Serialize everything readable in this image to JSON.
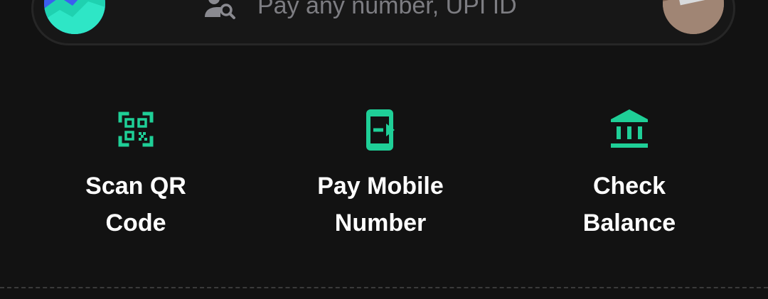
{
  "search": {
    "placeholder": "Pay any number, UPI ID"
  },
  "icons": {
    "logo": "app-logo",
    "search": "person-search-icon",
    "avatar": "profile-photo",
    "scan": "qr-scan-icon",
    "pay": "mobile-pay-icon",
    "balance": "bank-icon"
  },
  "actions": [
    {
      "label": "Scan QR\nCode"
    },
    {
      "label": "Pay Mobile\nNumber"
    },
    {
      "label": "Check\nBalance"
    }
  ],
  "colors": {
    "background": "#121212",
    "accent": "#1fcf97",
    "text": "#ffffff",
    "placeholder": "#7d7d82"
  }
}
